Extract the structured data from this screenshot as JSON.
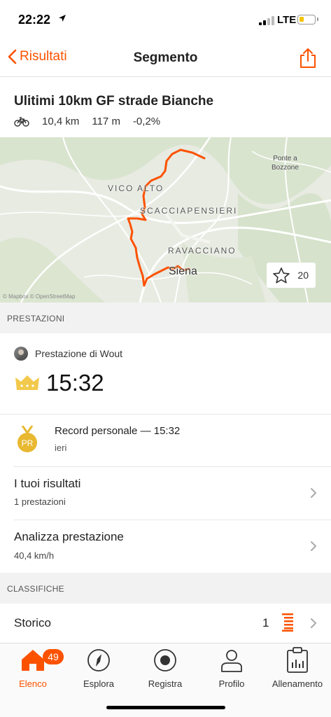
{
  "status_bar": {
    "time": "22:22",
    "network": "LTE"
  },
  "nav": {
    "back_label": "Risultati",
    "title": "Segmento"
  },
  "segment": {
    "name": "Ulitimi 10km GF strade Bianche",
    "distance": "10,4 km",
    "elevation": "117 m",
    "grade": "-0,2%",
    "icon": "bike-icon"
  },
  "map": {
    "labels": {
      "vico_alto": "VICO ALTO",
      "scacciapensieri": "SCACCIAPENSIERI",
      "ravacciano": "RAVACCIANO",
      "siena": "Siena",
      "ponte_a": "Ponte a",
      "bozzone": "Bozzone"
    },
    "copyright": "© Mapbox © OpenStreetMap",
    "star_count": "20",
    "route_color": "#fc5200"
  },
  "sections": {
    "performances": "PRESTAZIONI",
    "leaderboards": "CLASSIFICHE"
  },
  "performance": {
    "athlete_label": "Prestazione di Wout",
    "time": "15:32",
    "pr_title": "Record personale — 15:32",
    "pr_when": "ieri",
    "pr_medal_text": "PR"
  },
  "rows": {
    "your_results": {
      "title": "I tuoi risultati",
      "sub": "1 prestazioni"
    },
    "analyze": {
      "title": "Analizza prestazione",
      "sub": "40,4 km/h"
    },
    "history": {
      "title": "Storico",
      "count": "1"
    }
  },
  "tabs": [
    {
      "label": "Elenco",
      "icon": "home-icon",
      "badge": "49",
      "active": true
    },
    {
      "label": "Esplora",
      "icon": "compass-icon"
    },
    {
      "label": "Registra",
      "icon": "record-icon"
    },
    {
      "label": "Profilo",
      "icon": "profile-icon"
    },
    {
      "label": "Allenamento",
      "icon": "training-icon"
    }
  ],
  "colors": {
    "accent": "#fc5200",
    "crown": "#f2c94c",
    "medal": "#e8b830"
  }
}
